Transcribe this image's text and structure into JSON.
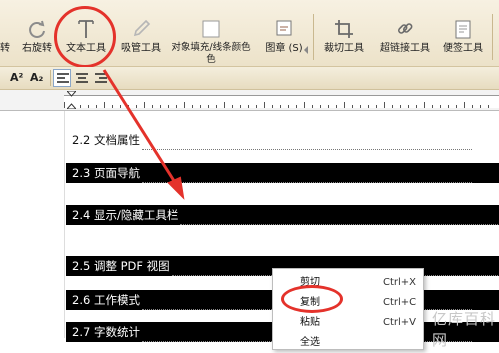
{
  "toolbar": {
    "tools": [
      {
        "label": "转",
        "icon": "rotate-left-icon"
      },
      {
        "label": "右旋转",
        "icon": "rotate-right-icon"
      },
      {
        "label": "文本工具",
        "icon": "text-tool-icon"
      },
      {
        "label": "吸管工具",
        "icon": "eyedropper-icon"
      },
      {
        "label": "对象填充/线条颜色",
        "label_line2": "色",
        "icon": "fill-color-icon"
      },
      {
        "label": "图章 (S)",
        "icon": "stamp-icon"
      },
      {
        "label": "裁切工具",
        "icon": "crop-icon"
      },
      {
        "label": "超链接工具",
        "icon": "link-icon"
      },
      {
        "label": "便签工具",
        "icon": "note-icon"
      }
    ]
  },
  "format_bar": {
    "superscript": "A²",
    "subscript": "A₂"
  },
  "document": {
    "toc": [
      {
        "text": "2.2 文档属性",
        "selected": false
      },
      {
        "text": "2.3 页面导航",
        "selected": true
      },
      {
        "text": "2.4 显示/隐藏工具栏",
        "selected": true
      },
      {
        "text": "2.5 调整 PDF 视图",
        "selected": true
      },
      {
        "text": "2.6 工作模式",
        "selected": true
      },
      {
        "text": "2.7 字数统计",
        "selected": true
      }
    ]
  },
  "context_menu": {
    "items": [
      {
        "label": "剪切",
        "shortcut": "Ctrl+X"
      },
      {
        "label": "复制",
        "shortcut": "Ctrl+C"
      },
      {
        "label": "粘贴",
        "shortcut": "Ctrl+V"
      },
      {
        "label": "全选",
        "shortcut": ""
      }
    ]
  },
  "watermark": "亿库百科网",
  "colors": {
    "highlight": "#e4322b",
    "selection": "#000000",
    "toolbar_bg": "#f1e9d5"
  }
}
